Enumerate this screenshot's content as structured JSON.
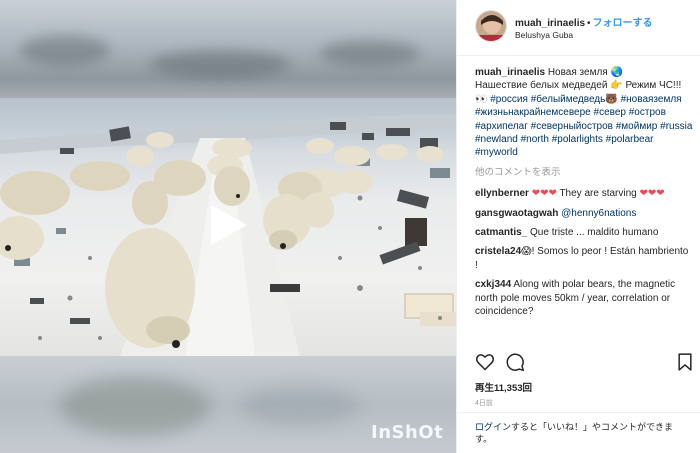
{
  "post": {
    "username": "muah_irinaelis",
    "follow_label": "フォローする",
    "location": "Belushya Guba",
    "caption_parts": [
      "Новая земля",
      "Нашествие белых медведей",
      "Режим ЧС!!!",
      "#россия",
      "#белыймедведь",
      "#новаяземля",
      "#жизньнакрайнемсевере",
      "#север",
      "#остров",
      "#архипелаг",
      "#северныйостров",
      "#моймир",
      "#russia",
      "#newland",
      "#north",
      "#polarlights",
      "#polarbear",
      "#myworld"
    ],
    "more_comments_label": "他のコメントを表示",
    "comments": [
      {
        "user": "ellynberner",
        "text": "They are starving",
        "hearts_before": 3,
        "hearts_after": 3
      },
      {
        "user": "gansgwaotagwah",
        "text": "@henny6nations"
      },
      {
        "user": "catmantis_",
        "text": "Que triste ... maldito humano"
      },
      {
        "user": "cristela24",
        "text": "! Somos lo peor ! Están hambriento !"
      },
      {
        "user": "cxkj344",
        "text": "Along with polar bears, the magnetic north pole moves 50km / year, correlation or coincidence?"
      }
    ],
    "views": "再生11,353回",
    "age": "4日前",
    "login_prompt": {
      "link": "ログイン",
      "rest": "すると「いいね！」やコメントができます。"
    }
  },
  "video": {
    "watermark": "InShOt"
  },
  "icons": {
    "like": "heart-outline-icon",
    "comment": "comment-bubble-icon",
    "save": "bookmark-icon",
    "play": "play-icon",
    "globe": "globe-emoji-icon",
    "pointing": "pointing-hand-emoji-icon",
    "eyes": "eyes-emoji-icon",
    "bear": "bear-emoji-icon",
    "scream": "screaming-face-emoji-icon"
  },
  "colors": {
    "link": "#003569",
    "follow": "#3897f0",
    "heart": "#ed4956",
    "muted": "#999999"
  }
}
